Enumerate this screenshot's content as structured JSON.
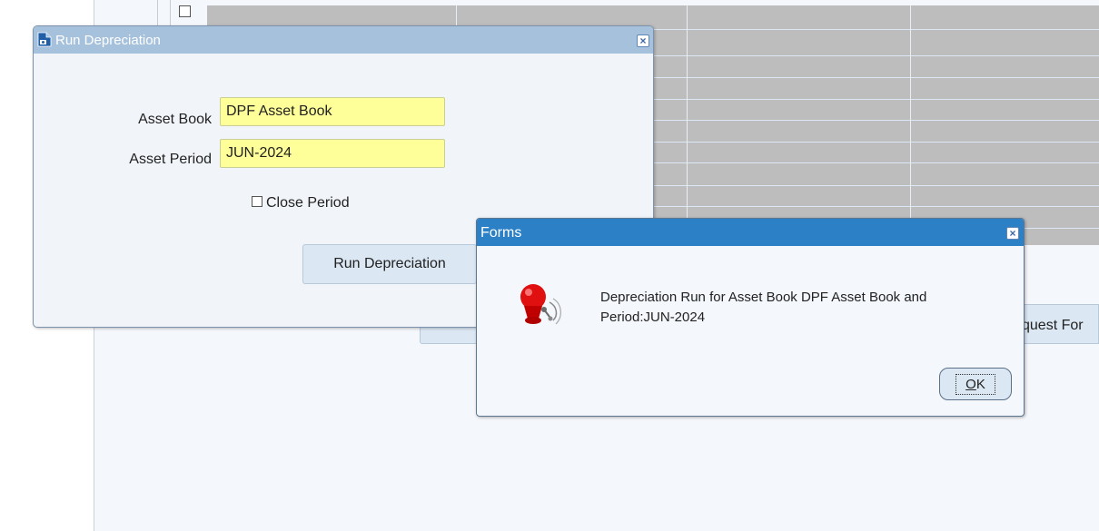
{
  "run_depreciation_window": {
    "title": "Run Depreciation",
    "asset_book_label": "Asset Book",
    "asset_book_value": "DPF Asset Book",
    "asset_period_label": "Asset Period",
    "asset_period_value": "JUN-2024",
    "close_period_label": "Close Period",
    "close_period_checked": false,
    "run_button_label": "Run Depreciation"
  },
  "forms_dialog": {
    "title": "Forms",
    "message": "Depreciation Run for Asset Book DPF Asset Book and Period:JUN-2024",
    "ok_underlined": "O",
    "ok_rest": "K"
  },
  "background": {
    "partial_button_label": "quest For"
  },
  "colors": {
    "required_field": "#ffff99",
    "active_titlebar": "#2c80c6",
    "inactive_titlebar": "#a6c1dc"
  },
  "icons": {
    "window_icon": "form-document-icon",
    "dialog_icon": "alarm-bell-icon",
    "close": "close-icon"
  }
}
